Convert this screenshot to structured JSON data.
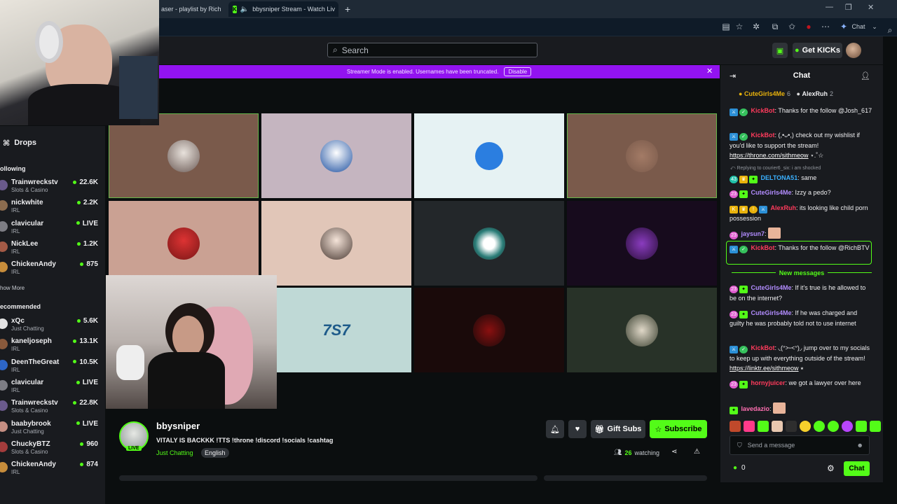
{
  "browser": {
    "tabs": [
      {
        "title": "aser - playlist by Rich"
      },
      {
        "title": "bbysniper Stream - Watch Liv"
      }
    ],
    "new_tab": "+",
    "copilot_label": "Chat"
  },
  "header": {
    "search_placeholder": "Search",
    "get_kicks_label": "Get KICKs"
  },
  "banner": {
    "text": "Streamer Mode is enabled. Usernames have been truncated.",
    "disable_label": "Disable"
  },
  "sidebar": {
    "drops_label": "Drops",
    "following_label": "ollowing",
    "show_more_label": "how More",
    "recommended_label": "ecommended",
    "following": [
      {
        "name": "Trainwreckstv",
        "category": "Slots & Casino",
        "viewers": "22.6K",
        "color": "#6a5a8c"
      },
      {
        "name": "nickwhite",
        "category": "IRL",
        "viewers": "2.2K",
        "color": "#8b6c4f"
      },
      {
        "name": "clavicular",
        "category": "IRL",
        "viewers": "LIVE",
        "color": "#7d7d84"
      },
      {
        "name": "NickLee",
        "category": "IRL",
        "viewers": "1.2K",
        "color": "#a35a46"
      },
      {
        "name": "ChickenAndy",
        "category": "IRL",
        "viewers": "875",
        "color": "#c78d3b"
      }
    ],
    "recommended": [
      {
        "name": "xQc",
        "category": "Just Chatting",
        "viewers": "5.6K",
        "color": "#e3e3e3"
      },
      {
        "name": "kaneljoseph",
        "category": "IRL",
        "viewers": "13.1K",
        "color": "#8a5a3c"
      },
      {
        "name": "DeenTheGreat",
        "category": "IRL",
        "viewers": "10.5K",
        "color": "#2d66c7"
      },
      {
        "name": "clavicular",
        "category": "IRL",
        "viewers": "LIVE",
        "color": "#7d7d84"
      },
      {
        "name": "Trainwreckstv",
        "category": "Slots & Casino",
        "viewers": "22.8K",
        "color": "#6a5a8c"
      },
      {
        "name": "baabybrook",
        "category": "Just Chatting",
        "viewers": "LIVE",
        "color": "#c48e82"
      },
      {
        "name": "ChuckyBTZ",
        "category": "Slots & Casino",
        "viewers": "960",
        "color": "#a33c3c"
      },
      {
        "name": "ChickenAndy",
        "category": "IRL",
        "viewers": "874",
        "color": "#c78d3b"
      }
    ]
  },
  "stream": {
    "streamer": "bbysniper",
    "live_label": "LIVE",
    "title": "VITALY IS BACKKK !TTS !throne !discord !socials !cashtag",
    "category": "Just Chatting",
    "language": "English",
    "gift_label": "Gift Subs",
    "subscribe_label": "Subscribe",
    "watching_count": "26",
    "watching_label": "watching"
  },
  "chat": {
    "title": "Chat",
    "gifters": [
      {
        "name": "CuteGirls4Me",
        "count": "6"
      },
      {
        "name": "AlexRuh",
        "count": "2"
      }
    ],
    "reply_note": "Replying to courier6_six: i am shocked",
    "new_messages_label": "New messages",
    "messages": [
      {
        "user": "KickBot",
        "color": "#ff3b5c",
        "text": ": Thanks for the follow @Josh_617"
      },
      {
        "user": "KickBot",
        "color": "#ff3b5c",
        "text": ": (,•ᴗ•,) check out my wishlist if you'd like to support the stream!",
        "link": "https://throne.com/sithmeow",
        "suffix": " ⋆.˚☆"
      },
      {
        "user": "DELTONA51",
        "color": "#3ab0ff",
        "text": ": same"
      },
      {
        "user": "CuteGirls4Me",
        "color": "#b28cff",
        "text": ": Izzy a pedo?"
      },
      {
        "user": "AlexRuh",
        "color": "#ff3b5c",
        "text": ": its looking like child porn possession"
      },
      {
        "user": "jaysun7",
        "color": "#b28cff",
        "text": ":"
      },
      {
        "user": "KickBot",
        "color": "#ff3b5c",
        "text": ": Thanks for the follow @RichBTV"
      },
      {
        "user": "CuteGirls4Me",
        "color": "#b28cff",
        "text": ": If it's true is he allowed to be on the internet?"
      },
      {
        "user": "CuteGirls4Me",
        "color": "#b28cff",
        "text": ": If he was charged and guilty he was probably told not to use internet"
      },
      {
        "user": "KickBot",
        "color": "#ff3b5c",
        "text": ": ◟(ᐡ˃ᵕ˂ᐡ)◞ jump over to my socials to keep up with everything outside of the stream!",
        "link": "https://linktr.ee/sithmeow",
        "suffix": " ⭑"
      },
      {
        "user": "hornyjuicer",
        "color": "#ff3b5c",
        "text": ": we got a lawyer over here"
      },
      {
        "user": "lavedazio",
        "color": "#ff6fb1",
        "text": ":"
      }
    ],
    "input_placeholder": "Send a message",
    "kicks_count": "0",
    "send_label": "Chat"
  }
}
